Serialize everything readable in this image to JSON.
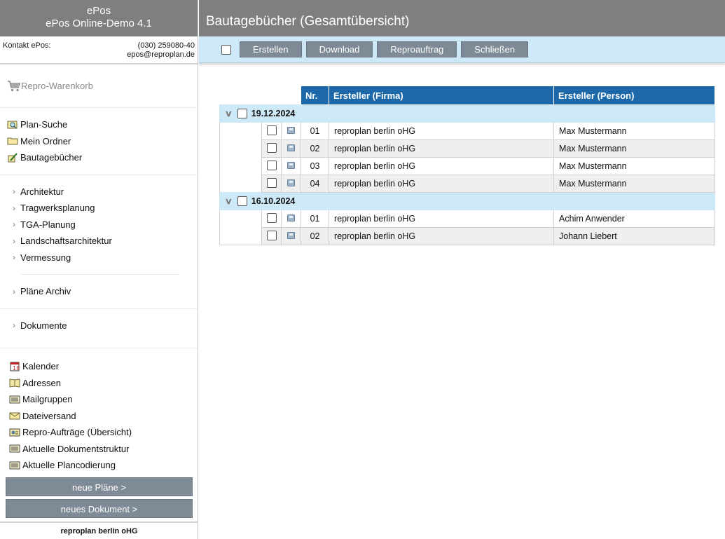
{
  "brand": {
    "line1": "ePos",
    "line2": "ePos Online-Demo 4.1"
  },
  "contact": {
    "label": "Kontakt ePos:",
    "phone": "(030) 259080-40",
    "email": "epos@reproplan.de"
  },
  "cart": {
    "label": "Repro-Warenkorb"
  },
  "menu_primary": [
    {
      "label": "Plan-Suche",
      "icon": "magnifier-map-icon"
    },
    {
      "label": "Mein Ordner",
      "icon": "folder-icon"
    },
    {
      "label": "Bautagebücher",
      "icon": "pencil-book-icon"
    }
  ],
  "nav_plans": [
    "Architektur",
    "Tragwerksplanung",
    "TGA-Planung",
    "Landschaftsarchitektur",
    "Vermessung"
  ],
  "nav_archive": "Pläne Archiv",
  "nav_documents": "Dokumente",
  "menu_tools": [
    {
      "label": "Kalender",
      "icon": "calendar-icon"
    },
    {
      "label": "Adressen",
      "icon": "address-book-icon"
    },
    {
      "label": "Mailgruppen",
      "icon": "list-icon"
    },
    {
      "label": "Dateiversand",
      "icon": "envelope-icon"
    },
    {
      "label": "Repro-Aufträge (Übersicht)",
      "icon": "order-icon"
    },
    {
      "label": "Aktuelle Dokumentstruktur",
      "icon": "list-icon"
    },
    {
      "label": "Aktuelle Plancodierung",
      "icon": "list-icon"
    }
  ],
  "side_buttons": {
    "new_plans": "neue Pläne >",
    "new_document": "neues Dokument >"
  },
  "footer": {
    "company": "reproplan berlin oHG"
  },
  "page_title": "Bautagebücher (Gesamtübersicht)",
  "toolbar": {
    "create": "Erstellen",
    "download": "Download",
    "repro": "Reproauftrag",
    "close": "Schließen"
  },
  "table": {
    "headers": {
      "nr": "Nr.",
      "firm": "Ersteller (Firma)",
      "person": "Ersteller (Person)"
    },
    "groups": [
      {
        "date": "19.12.2024",
        "rows": [
          {
            "nr": "01",
            "firm": "reproplan berlin oHG",
            "person": "Max Mustermann"
          },
          {
            "nr": "02",
            "firm": "reproplan berlin oHG",
            "person": "Max Mustermann"
          },
          {
            "nr": "03",
            "firm": "reproplan berlin oHG",
            "person": "Max Mustermann"
          },
          {
            "nr": "04",
            "firm": "reproplan berlin oHG",
            "person": "Max Mustermann"
          }
        ]
      },
      {
        "date": "16.10.2024",
        "rows": [
          {
            "nr": "01",
            "firm": "reproplan berlin oHG",
            "person": "Achim Anwender"
          },
          {
            "nr": "02",
            "firm": "reproplan berlin oHG",
            "person": "Johann Liebert"
          }
        ]
      }
    ]
  }
}
